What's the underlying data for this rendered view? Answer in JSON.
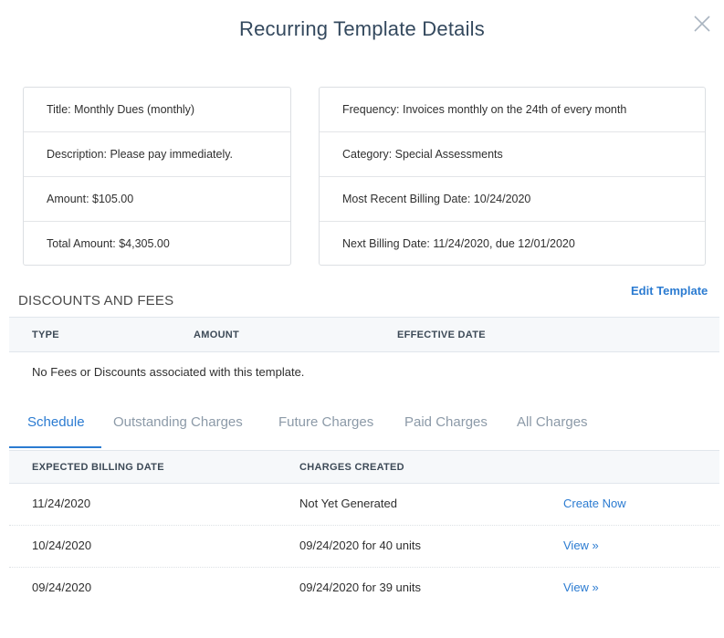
{
  "dialog": {
    "title": "Recurring Template Details",
    "close_icon": "close-x-icon"
  },
  "details_left": [
    {
      "label": "Title",
      "value": "Title: Monthly Dues (monthly)"
    },
    {
      "label": "Description",
      "value": "Description: Please pay immediately."
    },
    {
      "label": "Amount",
      "value": "Amount: $105.00"
    },
    {
      "label": "Total Amount",
      "value": "Total Amount: $4,305.00"
    }
  ],
  "details_right": [
    {
      "label": "Frequency",
      "value": "Frequency: Invoices monthly on the 24th of every month"
    },
    {
      "label": "Category",
      "value": "Category: Special Assessments"
    },
    {
      "label": "Most Recent Billing Date",
      "value": "Most Recent Billing Date: 10/24/2020"
    },
    {
      "label": "Next Billing Date",
      "value": "Next Billing Date: 11/24/2020, due 12/01/2020"
    }
  ],
  "discounts": {
    "section_title": "DISCOUNTS AND FEES",
    "edit_link": "Edit Template",
    "columns": [
      "TYPE",
      "AMOUNT",
      "EFFECTIVE DATE"
    ],
    "empty_message": "No Fees or Discounts associated with this template."
  },
  "tabs": [
    {
      "label": "Schedule",
      "active": true
    },
    {
      "label": "Outstanding Charges",
      "active": false
    },
    {
      "label": "Future Charges",
      "active": false
    },
    {
      "label": "Paid Charges",
      "active": false
    },
    {
      "label": "All Charges",
      "active": false
    }
  ],
  "schedule": {
    "columns": [
      "EXPECTED BILLING DATE",
      "CHARGES CREATED"
    ],
    "rows": [
      {
        "date": "11/24/2020",
        "charges": "Not Yet Generated",
        "action": "Create Now"
      },
      {
        "date": "10/24/2020",
        "charges": "09/24/2020 for 40 units",
        "action": "View »"
      },
      {
        "date": "09/24/2020",
        "charges": "09/24/2020 for 39 units",
        "action": "View »"
      }
    ]
  },
  "colors": {
    "accent": "#2b7bd1",
    "title": "#34495e",
    "inactive_tab": "#8c9aa8",
    "header_bg": "#f6f8fa"
  }
}
